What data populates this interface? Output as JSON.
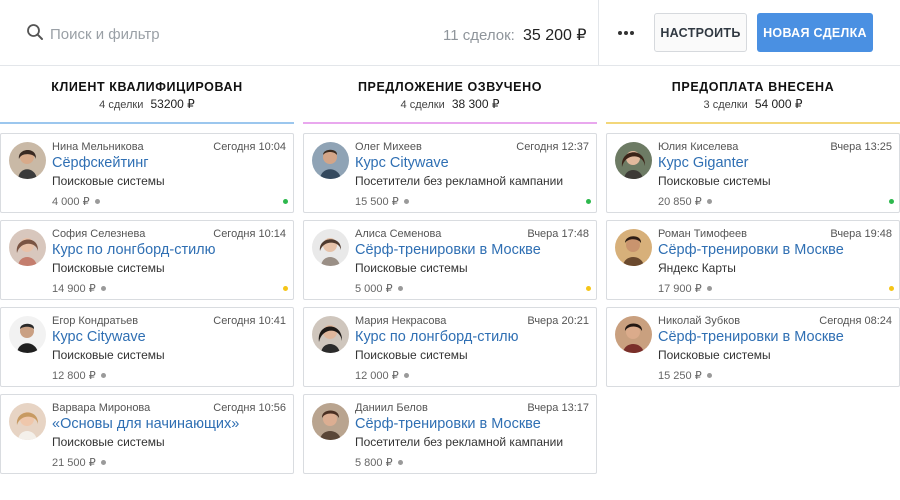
{
  "search": {
    "placeholder": "Поиск и фильтр",
    "icon": "search-icon"
  },
  "summary": {
    "count_label": "11 сделок:",
    "total": "35 200 ₽"
  },
  "toolbar": {
    "more_icon": "more-icon",
    "configure_label": "НАСТРОИТЬ",
    "new_deal_label": "НОВАЯ СДЕЛКА"
  },
  "colors": {
    "accent_blue": "#4a90e2",
    "link_blue": "#2f6fb3",
    "status_green": "#2db84d",
    "status_yellow": "#f5c518",
    "col1_line": "#9cc7ee",
    "col2_line": "#e9a8ee",
    "col3_line": "#f3d77a"
  },
  "columns": [
    {
      "title": "КЛИЕНТ КВАЛИФИЦИРОВАН",
      "count": "4 сделки",
      "amount": "53200 ₽",
      "line_color": "#9cc7ee",
      "cards": [
        {
          "name": "Нина Мельникова",
          "time": "Сегодня 10:04",
          "deal": "Сёрфскейтинг",
          "source": "Поисковые системы",
          "price": "4 000 ₽",
          "status": "green"
        },
        {
          "name": "София Селезнева",
          "time": "Сегодня 10:14",
          "deal": "Курс по лонгборд-стилю",
          "source": "Поисковые системы",
          "price": "14 900 ₽",
          "status": "yellow"
        },
        {
          "name": "Егор Кондратьев",
          "time": "Сегодня 10:41",
          "deal": "Курс Citywave",
          "source": "Поисковые системы",
          "price": "12 800 ₽",
          "status": "none"
        },
        {
          "name": "Варвара Миронова",
          "time": "Сегодня 10:56",
          "deal": "«Основы для начинающих»",
          "source": "Поисковые системы",
          "price": "21 500 ₽",
          "status": "none"
        }
      ]
    },
    {
      "title": "ПРЕДЛОЖЕНИЕ ОЗВУЧЕНО",
      "count": "4 сделки",
      "amount": "38 300 ₽",
      "line_color": "#e9a8ee",
      "cards": [
        {
          "name": "Олег Михеев",
          "time": "Сегодня 12:37",
          "deal": "Курс Citywave",
          "source": "Посетители без рекламной кампании",
          "price": "15 500 ₽",
          "status": "green"
        },
        {
          "name": "Алиса Семенова",
          "time": "Вчера 17:48",
          "deal": "Сёрф-тренировки в Москве",
          "source": "Поисковые системы",
          "price": "5 000 ₽",
          "status": "yellow"
        },
        {
          "name": "Мария Некрасова",
          "time": "Вчера 20:21",
          "deal": "Курс по лонгборд-стилю",
          "source": "Поисковые системы",
          "price": "12 000 ₽",
          "status": "none"
        },
        {
          "name": "Даниил Белов",
          "time": "Вчера 13:17",
          "deal": "Сёрф-тренировки в Москве",
          "source": "Посетители без рекламной кампании",
          "price": "5 800 ₽",
          "status": "none"
        }
      ]
    },
    {
      "title": "ПРЕДОПЛАТА ВНЕСЕНА",
      "count": "3 сделки",
      "amount": "54 000 ₽",
      "line_color": "#f3d77a",
      "cards": [
        {
          "name": "Юлия Киселева",
          "time": "Вчера 13:25",
          "deal": "Курс Giganter",
          "source": "Поисковые системы",
          "price": "20 850 ₽",
          "status": "green"
        },
        {
          "name": "Роман Тимофеев",
          "time": "Вчера 19:48",
          "deal": "Сёрф-тренировки в Москве",
          "source": "Яндекс Карты",
          "price": "17 900 ₽",
          "status": "yellow"
        },
        {
          "name": "Николай Зубков",
          "time": "Сегодня 08:24",
          "deal": "Сёрф-тренировки в Москве",
          "source": "Поисковые системы",
          "price": "15 250 ₽",
          "status": "none"
        }
      ]
    }
  ]
}
